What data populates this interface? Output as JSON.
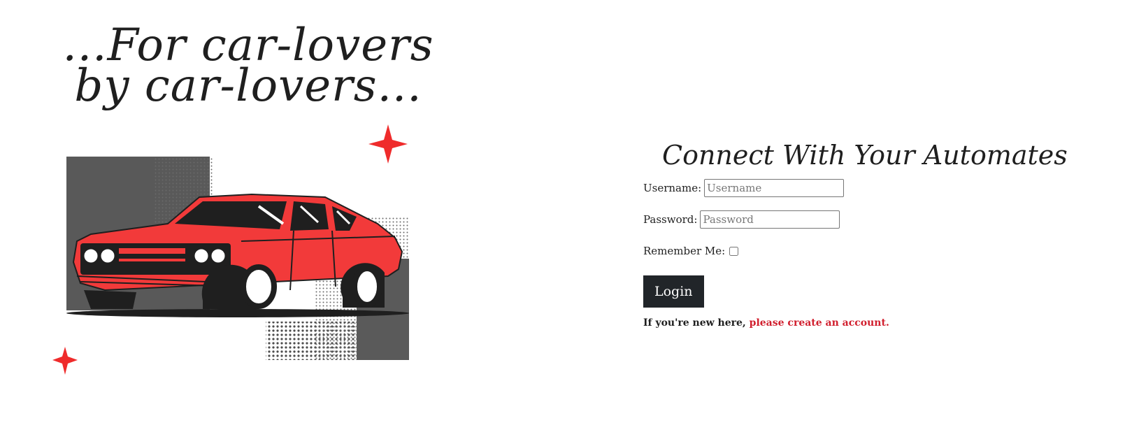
{
  "hero": {
    "tagline_line1": "...For car-lovers",
    "tagline_line2": "by car-lovers..."
  },
  "login": {
    "title": "Connect With Your Automates",
    "username_label": "Username:",
    "username_placeholder": "Username",
    "username_value": "",
    "password_label": "Password:",
    "password_placeholder": "Password",
    "password_value": "",
    "remember_label": "Remember Me:",
    "remember_checked": false,
    "submit_label": "Login",
    "signup_prefix": "If you're new here, ",
    "signup_link": "please create an account."
  },
  "colors": {
    "car_red": "#f23a3a",
    "dark": "#212529",
    "link_red": "#d11f2e"
  }
}
